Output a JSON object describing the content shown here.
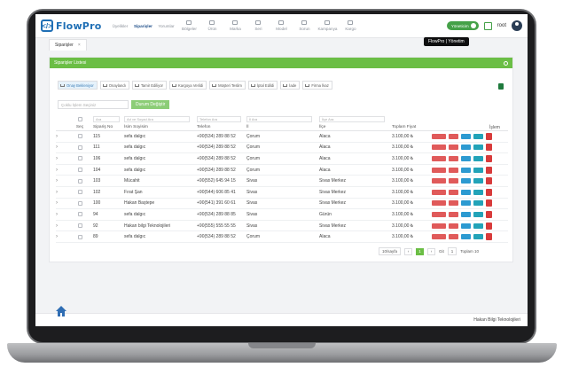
{
  "app": {
    "logo_text": "FlowPro",
    "user": "root",
    "toggle_label": "Yöneticim",
    "tooltip": "FlowPro | Yönetim"
  },
  "nav": [
    {
      "label": "Üyelikler",
      "icon": "users-icon",
      "active": false
    },
    {
      "label": "Siparişler",
      "icon": "orders-icon",
      "active": true
    },
    {
      "label": "Yorumlar",
      "icon": "comments-icon",
      "active": false
    },
    {
      "label": "Bölgeler",
      "icon": "region-icon",
      "active": false
    },
    {
      "label": "Ürün",
      "icon": "product-icon",
      "active": false
    },
    {
      "label": "Marka",
      "icon": "brand-icon",
      "active": false
    },
    {
      "label": "Seri",
      "icon": "series-icon",
      "active": false
    },
    {
      "label": "Model",
      "icon": "model-icon",
      "active": false
    },
    {
      "label": "Sorun",
      "icon": "issue-icon",
      "active": false
    },
    {
      "label": "Kampanya",
      "icon": "campaign-icon",
      "active": false
    },
    {
      "label": "Kargo",
      "icon": "cargo-icon",
      "active": false
    }
  ],
  "tab": {
    "label": "Siparişler",
    "close": "×"
  },
  "card": {
    "title": "Siparişler Listesi"
  },
  "filters": [
    "Onay Bekleniyor",
    "Onaylandı",
    "Tamir Ediliyor",
    "Kargoya Verildi",
    "Müşteri Teslim",
    "İptal Edildi",
    "İade",
    "Firma İkaz"
  ],
  "bulk": {
    "placeholder": "Çoklu İşlem Seçiniz",
    "button": "Durum Değiştir"
  },
  "table": {
    "filter_placeholders": {
      "no": "Ara",
      "name": "Ad ve Soyad Ara",
      "tel": "Telefon Ara",
      "il": "İl Ara",
      "ilce": "İlçe Ara"
    },
    "headers": {
      "sec": "Seç",
      "no": "Sipariş No",
      "name": "İsim Soyisim",
      "tel": "Telefon",
      "il": "İl",
      "ilce": "İlçe",
      "price": "Toplam Fiyat",
      "islem": "İşlem"
    },
    "rows": [
      {
        "no": "115",
        "name": "sefa dalgıc",
        "tel": "+90(534) 289 88 52",
        "il": "Çorum",
        "ilce": "Alaca",
        "price": "3.100,00 ₺"
      },
      {
        "no": "111",
        "name": "sefa dalgıc",
        "tel": "+90(534) 289 88 52",
        "il": "Çorum",
        "ilce": "Alaca",
        "price": "3.100,00 ₺"
      },
      {
        "no": "106",
        "name": "sefa dalgıc",
        "tel": "+90(534) 289 88 52",
        "il": "Çorum",
        "ilce": "Alaca",
        "price": "3.100,00 ₺"
      },
      {
        "no": "104",
        "name": "sefa dalgıc",
        "tel": "+90(534) 289 88 52",
        "il": "Çorum",
        "ilce": "Alaca",
        "price": "3.100,00 ₺"
      },
      {
        "no": "103",
        "name": "Mücahit",
        "tel": "+90(552) 645 94 15",
        "il": "Sivas",
        "ilce": "Sivas Merkez",
        "price": "3.100,00 ₺"
      },
      {
        "no": "102",
        "name": "Fırat Şan",
        "tel": "+90(544) 606 85 41",
        "il": "Sivas",
        "ilce": "Sivas Merkez",
        "price": "3.100,00 ₺"
      },
      {
        "no": "100",
        "name": "Hakan Baştepe",
        "tel": "+90(541) 391 60 61",
        "il": "Sivas",
        "ilce": "Sivas Merkez",
        "price": "3.100,00 ₺"
      },
      {
        "no": "94",
        "name": "sefa dalgıc",
        "tel": "+90(534) 289 88 85",
        "il": "Sivas",
        "ilce": "Gürün",
        "price": "3.100,00 ₺"
      },
      {
        "no": "92",
        "name": "Hakan bilgi Teknolojileri",
        "tel": "+90(555) 555 55 55",
        "il": "Sivas",
        "ilce": "Sivas Merkez",
        "price": "3.100,00 ₺"
      },
      {
        "no": "89",
        "name": "sefa dalgıc",
        "tel": "+90(534) 289 88 52",
        "il": "Çorum",
        "ilce": "Alaca",
        "price": "3.100,00 ₺"
      }
    ]
  },
  "pager": {
    "per_page": "10/sayfa",
    "current": "1",
    "goto_label": "Git",
    "goto_value": "1",
    "total": "Toplam 10"
  },
  "footer": {
    "text": "Hakan Bilgi Teknolojileri"
  }
}
